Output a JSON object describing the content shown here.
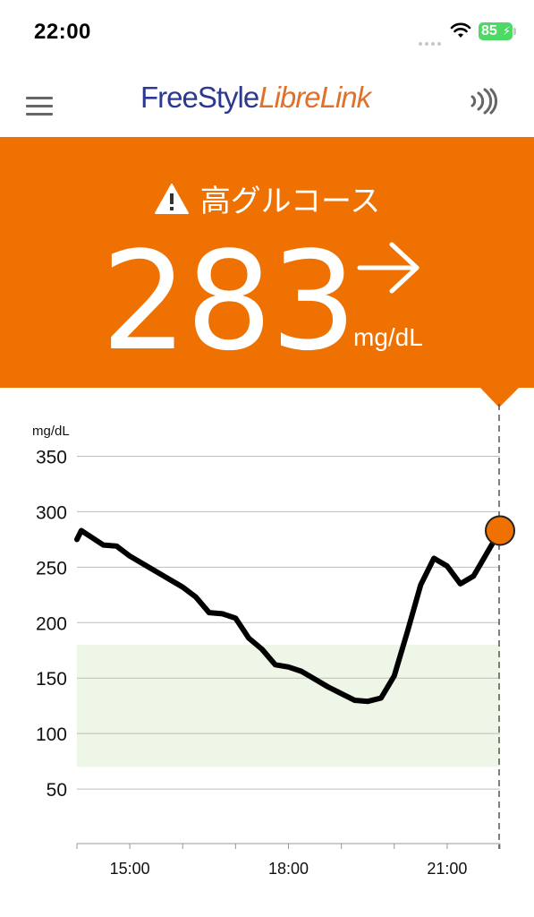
{
  "status_bar": {
    "time": "22:00",
    "battery": "85"
  },
  "header": {
    "logo_part1": "FreeStyle",
    "logo_part2": "LibreLink",
    "menu_icon": "hamburger-menu-icon",
    "scan_icon": "nfc-scan-icon"
  },
  "alert": {
    "icon": "warning-icon",
    "text": "高グルコース",
    "value": "283",
    "trend": "right-arrow",
    "unit": "mg/dL"
  },
  "colors": {
    "banner": "#ee7102",
    "target_range": "#edf6e7",
    "line": "#000000",
    "current_point": "#ee7102"
  },
  "chart_data": {
    "type": "line",
    "ylabel": "mg/dL",
    "ylim": [
      0,
      350
    ],
    "yticks": [
      50,
      100,
      150,
      200,
      250,
      300,
      350
    ],
    "xticks": [
      "15:00",
      "18:00",
      "21:00"
    ],
    "x_range": [
      "14:00",
      "22:00"
    ],
    "target_range": [
      70,
      180
    ],
    "series": [
      {
        "x": [
          "14:00",
          "14:05",
          "14:30",
          "14:45",
          "15:00",
          "15:30",
          "16:00",
          "16:15",
          "16:30",
          "16:45",
          "17:00",
          "17:15",
          "17:30",
          "17:45",
          "18:00",
          "18:15",
          "18:30",
          "18:45",
          "19:00",
          "19:15",
          "19:30",
          "19:45",
          "20:00",
          "20:15",
          "20:30",
          "20:45",
          "21:00",
          "21:15",
          "21:30",
          "22:00"
        ],
        "values": [
          275,
          283,
          270,
          269,
          260,
          246,
          232,
          223,
          209,
          208,
          204,
          186,
          176,
          162,
          160,
          156,
          149,
          142,
          136,
          130,
          129,
          132,
          152,
          192,
          234,
          258,
          251,
          235,
          242,
          283
        ]
      }
    ],
    "current": {
      "x": "22:00",
      "value": 283
    }
  }
}
